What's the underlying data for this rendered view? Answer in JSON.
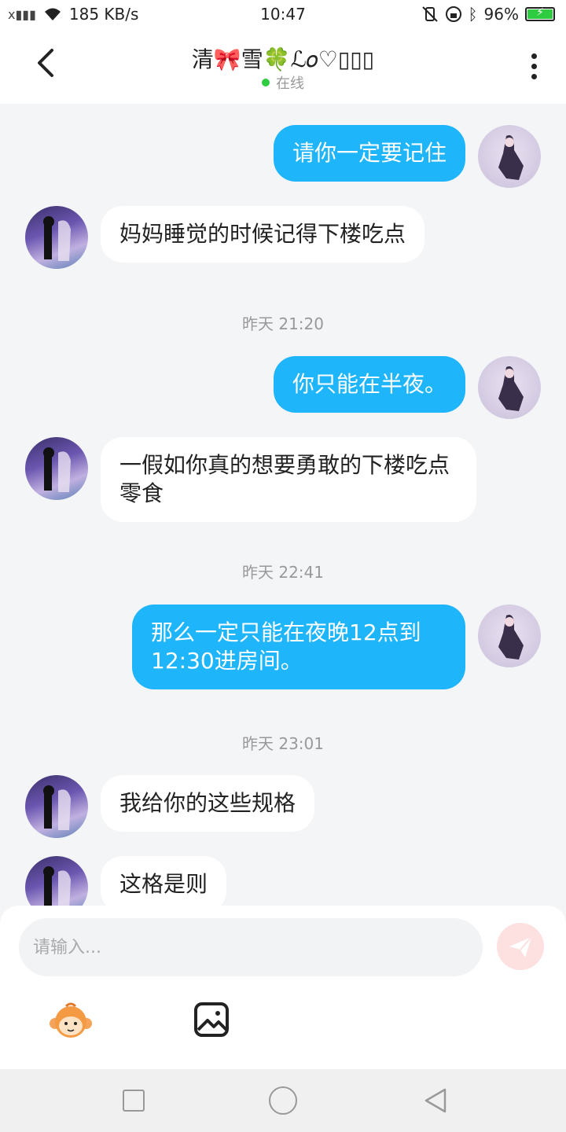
{
  "status": {
    "speed": "185 KB/s",
    "time": "10:47",
    "battery": "96%"
  },
  "header": {
    "title": "清🎀雪🍀ℒ𝑜♡▯▯▯",
    "online": "在线"
  },
  "messages": [
    {
      "side": "me",
      "text": "请你一定要记住"
    },
    {
      "side": "other",
      "text": "妈妈睡觉的时候记得下楼吃点"
    },
    {
      "timestamp": "昨天 21:20"
    },
    {
      "side": "me",
      "text": "你只能在半夜。"
    },
    {
      "side": "other",
      "text": "一假如你真的想要勇敢的下楼吃点零食"
    },
    {
      "timestamp": "昨天 22:41"
    },
    {
      "side": "me",
      "text": "那么一定只能在夜晚12点到12:30进房间。"
    },
    {
      "timestamp": "昨天 23:01"
    },
    {
      "side": "other",
      "text": "我给你的这些规格"
    },
    {
      "side": "other",
      "text": "这格是则"
    }
  ],
  "input": {
    "placeholder": "请输入..."
  },
  "colors": {
    "my_bubble": "#1fb5fb",
    "other_bubble": "#ffffff",
    "background": "#f4f5f7"
  },
  "icons": [
    "back-arrow-icon",
    "more-icon",
    "send-icon",
    "emoji-monkey-icon",
    "image-icon"
  ]
}
